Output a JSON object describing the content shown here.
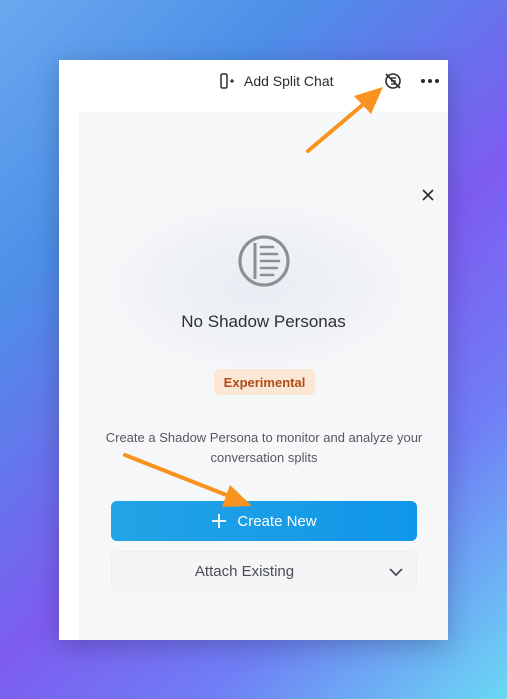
{
  "topbar": {
    "split_chat_label": "Add Split Chat",
    "split_chat_icon": "split-view-add-icon",
    "shadow_persona_icon": "shadow-persona-off-icon",
    "more_icon": "more-horizontal-icon"
  },
  "panel": {
    "close_icon": "close-icon",
    "empty_icon": "shadow-persona-icon",
    "title": "No Shadow Personas",
    "badge": "Experimental",
    "description": "Create a Shadow Persona to monitor and analyze your conversation splits",
    "create_button_label": "Create New",
    "create_button_icon": "plus-icon",
    "attach_select_value": "Attach Existing",
    "attach_select_icon": "chevron-down-icon"
  },
  "colors": {
    "primary_button": "#1a9fe8",
    "badge_bg": "#fbe7d5",
    "badge_text": "#b54a15",
    "annotation_arrow": "#f7931e"
  }
}
